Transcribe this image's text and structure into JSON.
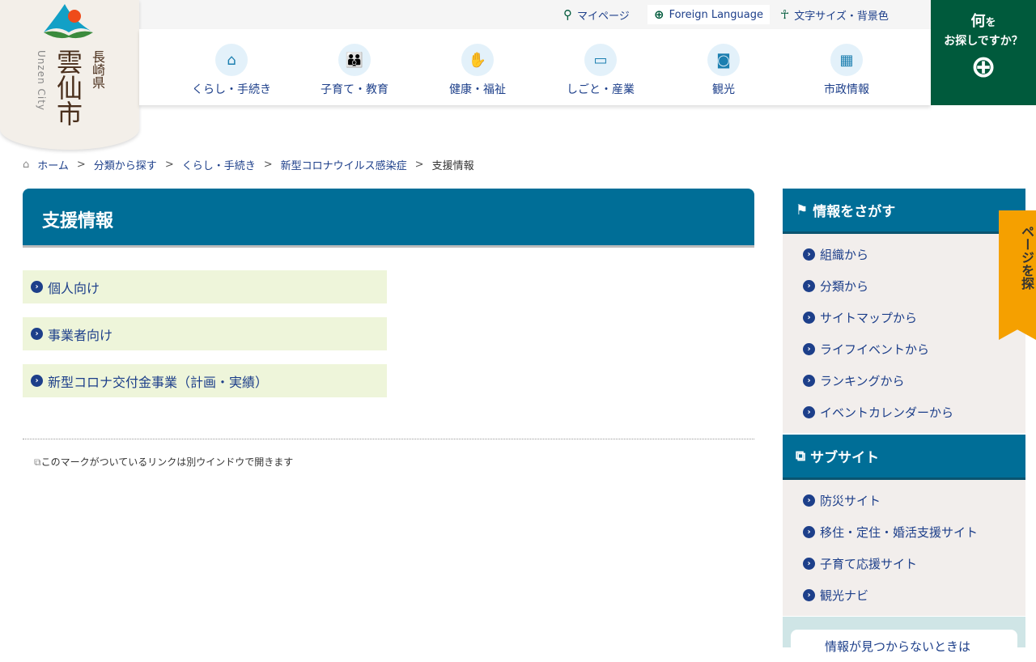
{
  "logo": {
    "pref": "長崎県",
    "city": "雲仙市",
    "roman": "Unzen City"
  },
  "util": {
    "mypage": "マイページ",
    "foreign": "Foreign Language",
    "textsize": "文字サイズ・背景色"
  },
  "nav": [
    "くらし・手続き",
    "子育て・教育",
    "健康・福祉",
    "しごと・産業",
    "観光",
    "市政情報"
  ],
  "search": {
    "line1": "何",
    "line1b": "を",
    "line2": "お探しですか？"
  },
  "breadcrumb": [
    "ホーム",
    "分類から探す",
    "くらし・手続き",
    "新型コロナウイルス感染症",
    "支援情報"
  ],
  "breadcrumb_sep": ">",
  "page_title": "支援情報",
  "links": [
    "個人向け",
    "事業者向け",
    "新型コロナ交付金事業（計画・実績）"
  ],
  "note": "このマークがついているリンクは別ウインドウで開きます",
  "sidebar": {
    "find_title": "情報をさがす",
    "find_items": [
      "組織から",
      "分類から",
      "サイトマップから",
      "ライフイベントから",
      "ランキングから",
      "イベントカレンダーから"
    ],
    "sub_title": "サブサイト",
    "sub_items": [
      "防災サイト",
      "移住・定住・婚活支援サイト",
      "子育て応援サイト",
      "観光ナビ"
    ],
    "help": "情報が見つからないときは"
  },
  "page_tab": "ページを探"
}
